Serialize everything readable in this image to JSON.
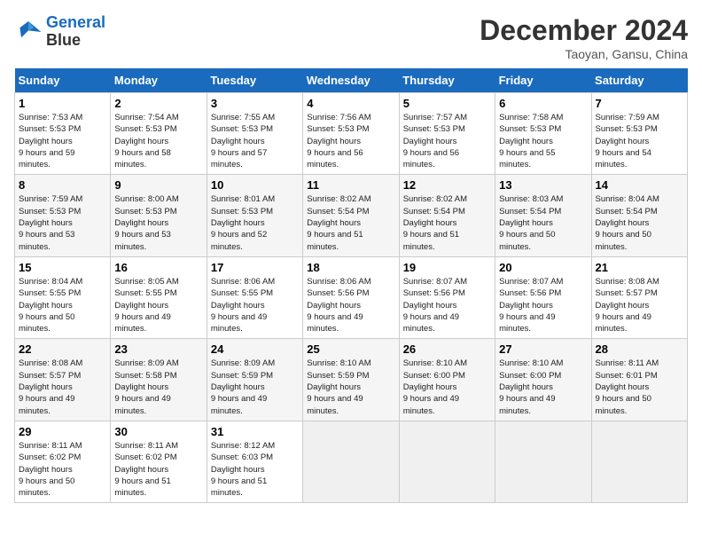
{
  "header": {
    "logo_line1": "General",
    "logo_line2": "Blue",
    "month": "December 2024",
    "location": "Taoyan, Gansu, China"
  },
  "weekdays": [
    "Sunday",
    "Monday",
    "Tuesday",
    "Wednesday",
    "Thursday",
    "Friday",
    "Saturday"
  ],
  "weeks": [
    [
      {
        "day": "1",
        "sunrise": "7:53 AM",
        "sunset": "5:53 PM",
        "daylight": "9 hours and 59 minutes."
      },
      {
        "day": "2",
        "sunrise": "7:54 AM",
        "sunset": "5:53 PM",
        "daylight": "9 hours and 58 minutes."
      },
      {
        "day": "3",
        "sunrise": "7:55 AM",
        "sunset": "5:53 PM",
        "daylight": "9 hours and 57 minutes."
      },
      {
        "day": "4",
        "sunrise": "7:56 AM",
        "sunset": "5:53 PM",
        "daylight": "9 hours and 56 minutes."
      },
      {
        "day": "5",
        "sunrise": "7:57 AM",
        "sunset": "5:53 PM",
        "daylight": "9 hours and 56 minutes."
      },
      {
        "day": "6",
        "sunrise": "7:58 AM",
        "sunset": "5:53 PM",
        "daylight": "9 hours and 55 minutes."
      },
      {
        "day": "7",
        "sunrise": "7:59 AM",
        "sunset": "5:53 PM",
        "daylight": "9 hours and 54 minutes."
      }
    ],
    [
      {
        "day": "8",
        "sunrise": "7:59 AM",
        "sunset": "5:53 PM",
        "daylight": "9 hours and 53 minutes."
      },
      {
        "day": "9",
        "sunrise": "8:00 AM",
        "sunset": "5:53 PM",
        "daylight": "9 hours and 53 minutes."
      },
      {
        "day": "10",
        "sunrise": "8:01 AM",
        "sunset": "5:53 PM",
        "daylight": "9 hours and 52 minutes."
      },
      {
        "day": "11",
        "sunrise": "8:02 AM",
        "sunset": "5:54 PM",
        "daylight": "9 hours and 51 minutes."
      },
      {
        "day": "12",
        "sunrise": "8:02 AM",
        "sunset": "5:54 PM",
        "daylight": "9 hours and 51 minutes."
      },
      {
        "day": "13",
        "sunrise": "8:03 AM",
        "sunset": "5:54 PM",
        "daylight": "9 hours and 50 minutes."
      },
      {
        "day": "14",
        "sunrise": "8:04 AM",
        "sunset": "5:54 PM",
        "daylight": "9 hours and 50 minutes."
      }
    ],
    [
      {
        "day": "15",
        "sunrise": "8:04 AM",
        "sunset": "5:55 PM",
        "daylight": "9 hours and 50 minutes."
      },
      {
        "day": "16",
        "sunrise": "8:05 AM",
        "sunset": "5:55 PM",
        "daylight": "9 hours and 49 minutes."
      },
      {
        "day": "17",
        "sunrise": "8:06 AM",
        "sunset": "5:55 PM",
        "daylight": "9 hours and 49 minutes."
      },
      {
        "day": "18",
        "sunrise": "8:06 AM",
        "sunset": "5:56 PM",
        "daylight": "9 hours and 49 minutes."
      },
      {
        "day": "19",
        "sunrise": "8:07 AM",
        "sunset": "5:56 PM",
        "daylight": "9 hours and 49 minutes."
      },
      {
        "day": "20",
        "sunrise": "8:07 AM",
        "sunset": "5:56 PM",
        "daylight": "9 hours and 49 minutes."
      },
      {
        "day": "21",
        "sunrise": "8:08 AM",
        "sunset": "5:57 PM",
        "daylight": "9 hours and 49 minutes."
      }
    ],
    [
      {
        "day": "22",
        "sunrise": "8:08 AM",
        "sunset": "5:57 PM",
        "daylight": "9 hours and 49 minutes."
      },
      {
        "day": "23",
        "sunrise": "8:09 AM",
        "sunset": "5:58 PM",
        "daylight": "9 hours and 49 minutes."
      },
      {
        "day": "24",
        "sunrise": "8:09 AM",
        "sunset": "5:59 PM",
        "daylight": "9 hours and 49 minutes."
      },
      {
        "day": "25",
        "sunrise": "8:10 AM",
        "sunset": "5:59 PM",
        "daylight": "9 hours and 49 minutes."
      },
      {
        "day": "26",
        "sunrise": "8:10 AM",
        "sunset": "6:00 PM",
        "daylight": "9 hours and 49 minutes."
      },
      {
        "day": "27",
        "sunrise": "8:10 AM",
        "sunset": "6:00 PM",
        "daylight": "9 hours and 49 minutes."
      },
      {
        "day": "28",
        "sunrise": "8:11 AM",
        "sunset": "6:01 PM",
        "daylight": "9 hours and 50 minutes."
      }
    ],
    [
      {
        "day": "29",
        "sunrise": "8:11 AM",
        "sunset": "6:02 PM",
        "daylight": "9 hours and 50 minutes."
      },
      {
        "day": "30",
        "sunrise": "8:11 AM",
        "sunset": "6:02 PM",
        "daylight": "9 hours and 51 minutes."
      },
      {
        "day": "31",
        "sunrise": "8:12 AM",
        "sunset": "6:03 PM",
        "daylight": "9 hours and 51 minutes."
      },
      null,
      null,
      null,
      null
    ]
  ]
}
